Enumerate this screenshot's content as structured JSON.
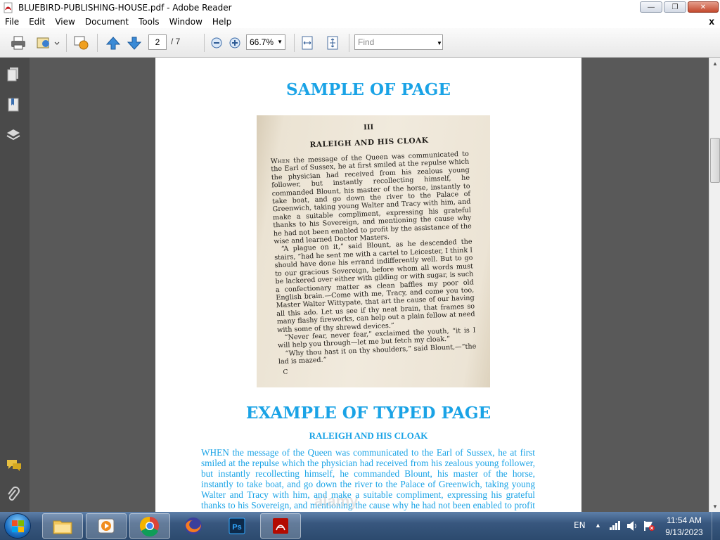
{
  "window": {
    "title": "BLUEBIRD-PUBLISHING-HOUSE.pdf - Adobe Reader",
    "buttons": {
      "minimize": "—",
      "restore": "❐",
      "close": "✕"
    }
  },
  "menu": {
    "items": [
      "File",
      "Edit",
      "View",
      "Document",
      "Tools",
      "Window",
      "Help"
    ],
    "close_glyph": "x"
  },
  "toolbar": {
    "current_page": "2",
    "total_pages": "/ 7",
    "zoom": "66.7%",
    "find_placeholder": "Find"
  },
  "document": {
    "sample_heading": "SAMPLE OF PAGE",
    "typed_heading": "EXAMPLE OF TYPED PAGE",
    "typed_subtitle": "RALEIGH AND HIS CLOAK",
    "typed_body": "WHEN the message of the Queen was communicated to the Earl of Sussex, he at first smiled at the repulse which the physician had received from his zealous young follower, but instantly recollecting himself, he commanded Blount, his master of the horse, instantly to take boat, and go down the river to the Palace of Greenwich, taking young Walter and Tracy with him, and make a suitable compliment, expressing his grateful thanks to his Sovereign, and mentioning the cause why he had not been enabled to profit by the",
    "watermark": "alamy",
    "scan": {
      "chapter": "III",
      "title": "RALEIGH AND HIS CLOAK",
      "paragraph1_lead": "When",
      "paragraph1": "the message of the Queen was communicated to the Earl of Sussex, he at first smiled at the repulse which the physician had received from his zealous young follower, but instantly recollecting himself, he commanded Blount, his master of the horse, instantly to take boat, and go down the river to the Palace of Greenwich, taking young Walter and Tracy with him, and make a suitable compliment, expressing his grateful thanks to his Sovereign, and mentioning the cause why he had not been enabled to profit by the assistance of the wise and learned Doctor Masters.",
      "paragraph2": "“A plague on it,” said Blount, as he descended the stairs, “had he sent me with a cartel to Leicester, I think I should have done his errand indifferently well. But to go to our gracious Sovereign, before whom all words must be lackered over either with gilding or with sugar, is such a confectionary matter as clean baffles my poor old English brain.—Come with me, Tracy, and come you too, Master Walter Wittypate, that art the cause of our having all this ado. Let us see if thy neat brain, that frames so many flashy fireworks, can help out a plain fellow at need with some of thy shrewd devices.”",
      "paragraph3": "“Never fear, never fear,” exclaimed the youth, “it is I will help you through—let me but fetch my cloak.”",
      "paragraph4": "“Why thou hast it on thy shoulders,” said Blount,—“the lad is mazed.”",
      "signature": "C"
    }
  },
  "taskbar": {
    "language": "EN",
    "time": "11:54 AM",
    "date": "9/13/2023"
  }
}
